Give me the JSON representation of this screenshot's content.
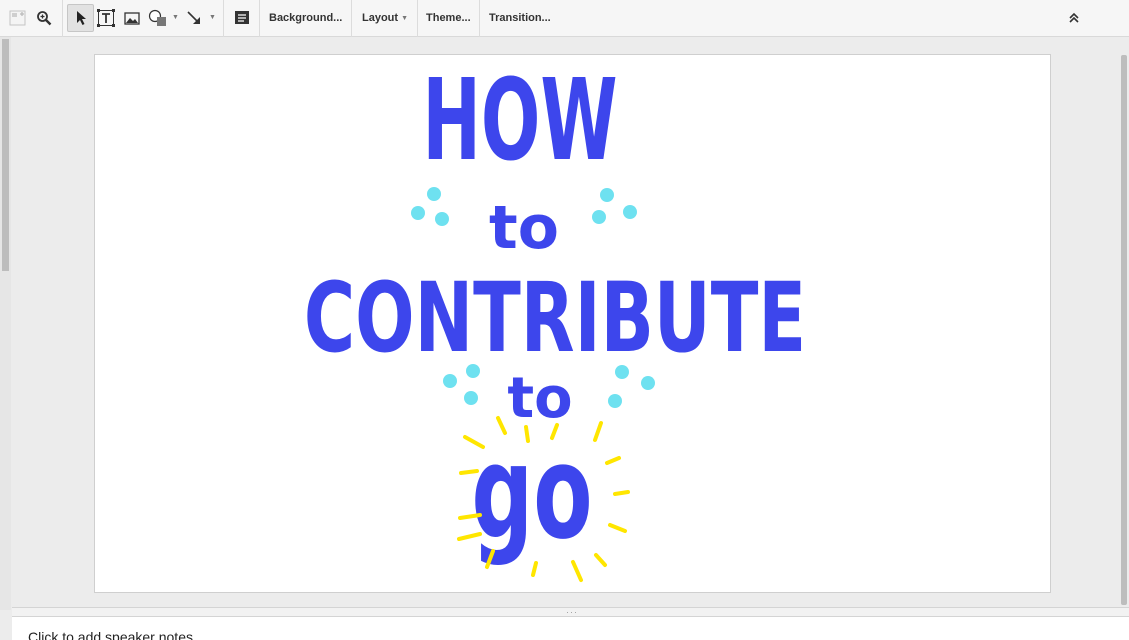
{
  "toolbar": {
    "background_label": "Background...",
    "layout_label": "Layout",
    "theme_label": "Theme...",
    "transition_label": "Transition...",
    "icons": [
      "new-slide-icon",
      "zoom-icon",
      "select-cursor-icon",
      "text-box-icon",
      "image-icon",
      "shape-icon",
      "line-icon",
      "speaker-notes-icon",
      "collapse-icon"
    ]
  },
  "slide": {
    "line1": "HOW",
    "line2": "to",
    "line3": "CONTRIBUTE",
    "line4": "to",
    "line5": "go",
    "colors": {
      "lettering": "#3d46ec",
      "dots": "#6ee1f0",
      "rays": "#ffe600"
    }
  },
  "notes": {
    "placeholder": "Click to add speaker notes"
  }
}
